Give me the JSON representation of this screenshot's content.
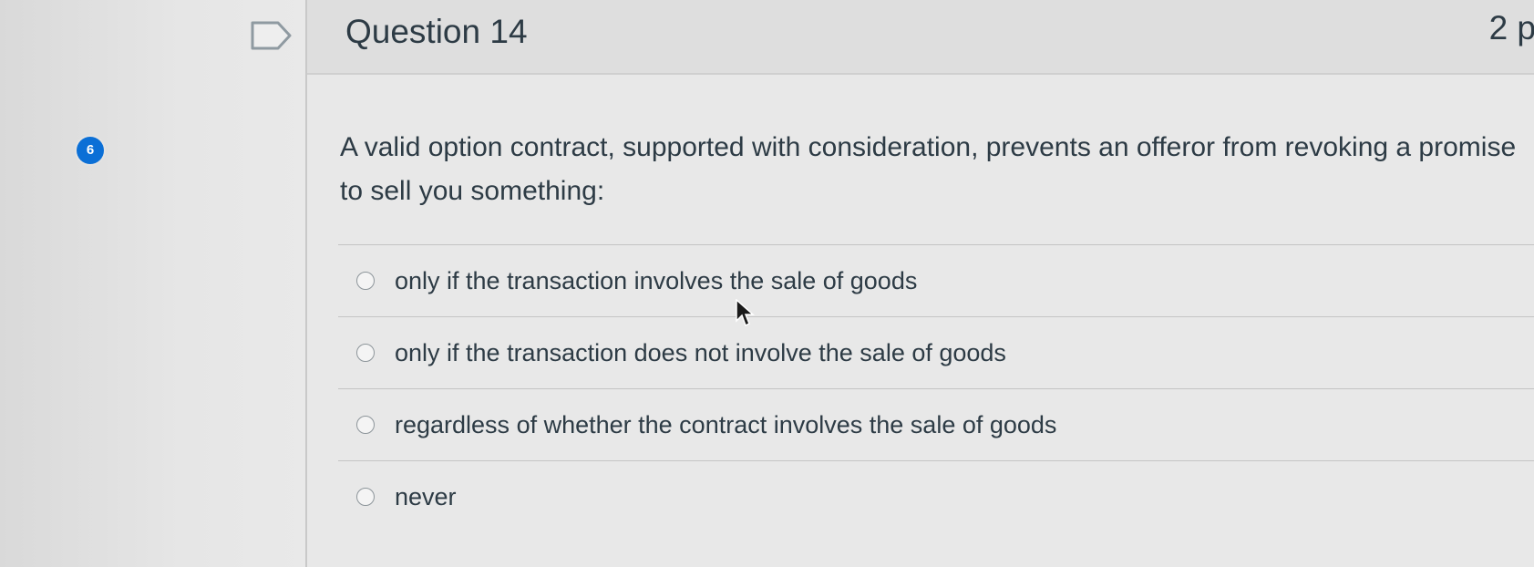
{
  "question": {
    "number_badge": "6",
    "title": "Question 14",
    "points": "2 p",
    "text": "A valid option contract, supported with consideration, prevents an offeror from revoking a promise to sell you something:",
    "answers": [
      {
        "label": "only if the transaction involves the sale of goods",
        "selected": false
      },
      {
        "label": "only if the transaction does not involve the sale of goods",
        "selected": false
      },
      {
        "label": "regardless of whether the contract involves the sale of goods",
        "selected": false
      },
      {
        "label": "never",
        "selected": false
      }
    ]
  },
  "icons": {
    "flag": "flag-question-icon",
    "cursor": "mouse-pointer-icon"
  },
  "colors": {
    "badge": "#0b6fd6",
    "text": "#2d3b45",
    "background": "#e8e8e8"
  }
}
